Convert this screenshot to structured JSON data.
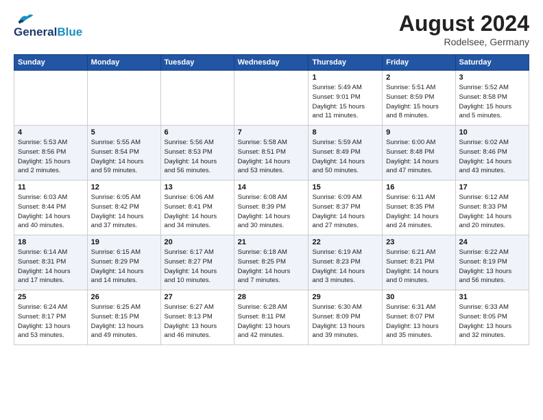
{
  "header": {
    "logo_general": "General",
    "logo_blue": "Blue",
    "month": "August 2024",
    "location": "Rodelsee, Germany"
  },
  "weekdays": [
    "Sunday",
    "Monday",
    "Tuesday",
    "Wednesday",
    "Thursday",
    "Friday",
    "Saturday"
  ],
  "weeks": [
    [
      {
        "day": "",
        "info": ""
      },
      {
        "day": "",
        "info": ""
      },
      {
        "day": "",
        "info": ""
      },
      {
        "day": "",
        "info": ""
      },
      {
        "day": "1",
        "info": "Sunrise: 5:49 AM\nSunset: 9:01 PM\nDaylight: 15 hours\nand 11 minutes."
      },
      {
        "day": "2",
        "info": "Sunrise: 5:51 AM\nSunset: 8:59 PM\nDaylight: 15 hours\nand 8 minutes."
      },
      {
        "day": "3",
        "info": "Sunrise: 5:52 AM\nSunset: 8:58 PM\nDaylight: 15 hours\nand 5 minutes."
      }
    ],
    [
      {
        "day": "4",
        "info": "Sunrise: 5:53 AM\nSunset: 8:56 PM\nDaylight: 15 hours\nand 2 minutes."
      },
      {
        "day": "5",
        "info": "Sunrise: 5:55 AM\nSunset: 8:54 PM\nDaylight: 14 hours\nand 59 minutes."
      },
      {
        "day": "6",
        "info": "Sunrise: 5:56 AM\nSunset: 8:53 PM\nDaylight: 14 hours\nand 56 minutes."
      },
      {
        "day": "7",
        "info": "Sunrise: 5:58 AM\nSunset: 8:51 PM\nDaylight: 14 hours\nand 53 minutes."
      },
      {
        "day": "8",
        "info": "Sunrise: 5:59 AM\nSunset: 8:49 PM\nDaylight: 14 hours\nand 50 minutes."
      },
      {
        "day": "9",
        "info": "Sunrise: 6:00 AM\nSunset: 8:48 PM\nDaylight: 14 hours\nand 47 minutes."
      },
      {
        "day": "10",
        "info": "Sunrise: 6:02 AM\nSunset: 8:46 PM\nDaylight: 14 hours\nand 43 minutes."
      }
    ],
    [
      {
        "day": "11",
        "info": "Sunrise: 6:03 AM\nSunset: 8:44 PM\nDaylight: 14 hours\nand 40 minutes."
      },
      {
        "day": "12",
        "info": "Sunrise: 6:05 AM\nSunset: 8:42 PM\nDaylight: 14 hours\nand 37 minutes."
      },
      {
        "day": "13",
        "info": "Sunrise: 6:06 AM\nSunset: 8:41 PM\nDaylight: 14 hours\nand 34 minutes."
      },
      {
        "day": "14",
        "info": "Sunrise: 6:08 AM\nSunset: 8:39 PM\nDaylight: 14 hours\nand 30 minutes."
      },
      {
        "day": "15",
        "info": "Sunrise: 6:09 AM\nSunset: 8:37 PM\nDaylight: 14 hours\nand 27 minutes."
      },
      {
        "day": "16",
        "info": "Sunrise: 6:11 AM\nSunset: 8:35 PM\nDaylight: 14 hours\nand 24 minutes."
      },
      {
        "day": "17",
        "info": "Sunrise: 6:12 AM\nSunset: 8:33 PM\nDaylight: 14 hours\nand 20 minutes."
      }
    ],
    [
      {
        "day": "18",
        "info": "Sunrise: 6:14 AM\nSunset: 8:31 PM\nDaylight: 14 hours\nand 17 minutes."
      },
      {
        "day": "19",
        "info": "Sunrise: 6:15 AM\nSunset: 8:29 PM\nDaylight: 14 hours\nand 14 minutes."
      },
      {
        "day": "20",
        "info": "Sunrise: 6:17 AM\nSunset: 8:27 PM\nDaylight: 14 hours\nand 10 minutes."
      },
      {
        "day": "21",
        "info": "Sunrise: 6:18 AM\nSunset: 8:25 PM\nDaylight: 14 hours\nand 7 minutes."
      },
      {
        "day": "22",
        "info": "Sunrise: 6:19 AM\nSunset: 8:23 PM\nDaylight: 14 hours\nand 3 minutes."
      },
      {
        "day": "23",
        "info": "Sunrise: 6:21 AM\nSunset: 8:21 PM\nDaylight: 14 hours\nand 0 minutes."
      },
      {
        "day": "24",
        "info": "Sunrise: 6:22 AM\nSunset: 8:19 PM\nDaylight: 13 hours\nand 56 minutes."
      }
    ],
    [
      {
        "day": "25",
        "info": "Sunrise: 6:24 AM\nSunset: 8:17 PM\nDaylight: 13 hours\nand 53 minutes."
      },
      {
        "day": "26",
        "info": "Sunrise: 6:25 AM\nSunset: 8:15 PM\nDaylight: 13 hours\nand 49 minutes."
      },
      {
        "day": "27",
        "info": "Sunrise: 6:27 AM\nSunset: 8:13 PM\nDaylight: 13 hours\nand 46 minutes."
      },
      {
        "day": "28",
        "info": "Sunrise: 6:28 AM\nSunset: 8:11 PM\nDaylight: 13 hours\nand 42 minutes."
      },
      {
        "day": "29",
        "info": "Sunrise: 6:30 AM\nSunset: 8:09 PM\nDaylight: 13 hours\nand 39 minutes."
      },
      {
        "day": "30",
        "info": "Sunrise: 6:31 AM\nSunset: 8:07 PM\nDaylight: 13 hours\nand 35 minutes."
      },
      {
        "day": "31",
        "info": "Sunrise: 6:33 AM\nSunset: 8:05 PM\nDaylight: 13 hours\nand 32 minutes."
      }
    ]
  ]
}
